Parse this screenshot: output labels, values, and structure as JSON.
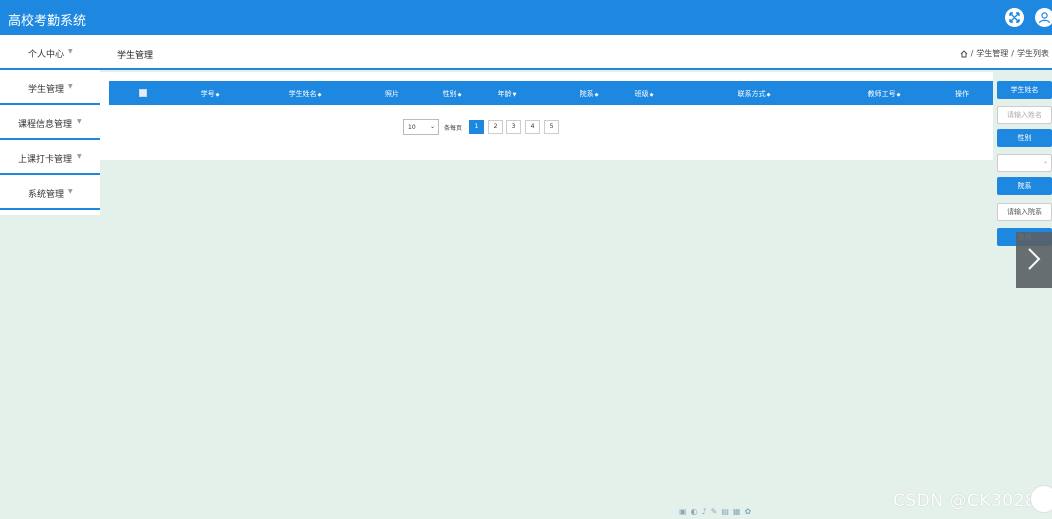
{
  "app": {
    "title": "高校考勤系统"
  },
  "sidebar": {
    "items": [
      {
        "label": "个人中心"
      },
      {
        "label": "学生管理"
      },
      {
        "label": "课程信息管理"
      },
      {
        "label": "上课打卡管理"
      },
      {
        "label": "系统管理"
      }
    ]
  },
  "header": {
    "title": "学生管理",
    "breadcrumb": [
      "学生管理",
      "学生列表"
    ],
    "separator": "/"
  },
  "table": {
    "columns": [
      "学号",
      "学生姓名",
      "照片",
      "性别",
      "年龄",
      "院系",
      "班级",
      "联系方式",
      "教师工号",
      "操作"
    ]
  },
  "pagination": {
    "page_size": "10",
    "per_page_label": "条每页",
    "pages": [
      "1",
      "2",
      "3",
      "4",
      "5"
    ],
    "current": "1"
  },
  "filters": {
    "name_label": "学生姓名",
    "name_placeholder": "请输入姓名",
    "gender_label": "性别",
    "dept_label": "院系",
    "dept_placeholder": "请输入院系",
    "query_label": "查询"
  },
  "watermark": "CSDN @CK3028",
  "colors": {
    "primary": "#1e88e0",
    "background": "#e4f1ea"
  }
}
